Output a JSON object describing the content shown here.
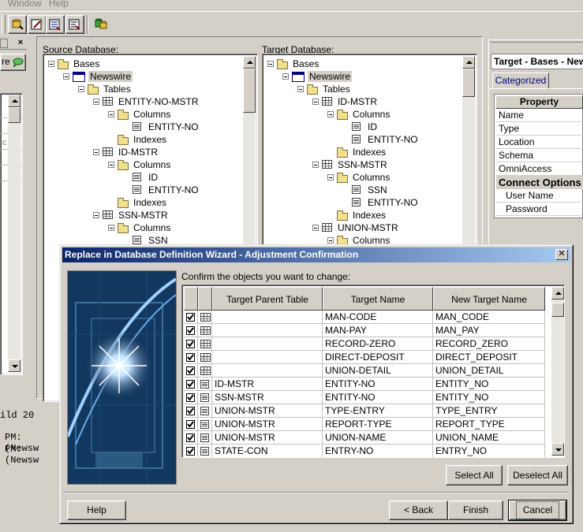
{
  "menu": [
    "Window",
    "Help"
  ],
  "toolbar": {
    "icons": [
      "connect-db-icon",
      "edit-icon",
      "properties-icon",
      "compare-icon",
      "databases-icon"
    ]
  },
  "left_fragment": {
    "button_label": "re",
    "text_c": "c",
    "console_lines": [
      "ild 20",
      "PM: (Newsw",
      "PM: (Newsw"
    ]
  },
  "source": {
    "label": "Source Database:",
    "nodes": [
      {
        "text": "Bases",
        "icon": "folder-icon"
      },
      {
        "text": "Newswire",
        "icon": "database-icon"
      },
      {
        "text": "Tables",
        "icon": "folder-icon"
      },
      {
        "text": "ENTITY-NO-MSTR",
        "icon": "table-icon"
      },
      {
        "text": "Columns",
        "icon": "folder-icon"
      },
      {
        "text": "ENTITY-NO",
        "icon": "column-icon"
      },
      {
        "text": "Indexes",
        "icon": "folder-icon"
      },
      {
        "text": "ID-MSTR",
        "icon": "table-icon"
      },
      {
        "text": "Columns",
        "icon": "folder-icon"
      },
      {
        "text": "ID",
        "icon": "column-icon"
      },
      {
        "text": "ENTITY-NO",
        "icon": "column-icon"
      },
      {
        "text": "Indexes",
        "icon": "folder-icon"
      },
      {
        "text": "SSN-MSTR",
        "icon": "table-icon"
      },
      {
        "text": "Columns",
        "icon": "folder-icon"
      },
      {
        "text": "SSN",
        "icon": "column-icon"
      }
    ]
  },
  "target": {
    "label": "Target Database:",
    "nodes": [
      {
        "text": "Bases",
        "icon": "folder-icon"
      },
      {
        "text": "Newswire",
        "icon": "database-icon"
      },
      {
        "text": "Tables",
        "icon": "folder-icon"
      },
      {
        "text": "ID-MSTR",
        "icon": "table-icon"
      },
      {
        "text": "Columns",
        "icon": "folder-icon"
      },
      {
        "text": "ID",
        "icon": "column-icon"
      },
      {
        "text": "ENTITY-NO",
        "icon": "column-icon"
      },
      {
        "text": "Indexes",
        "icon": "folder-icon"
      },
      {
        "text": "SSN-MSTR",
        "icon": "table-icon"
      },
      {
        "text": "Columns",
        "icon": "folder-icon"
      },
      {
        "text": "SSN",
        "icon": "column-icon"
      },
      {
        "text": "ENTITY-NO",
        "icon": "column-icon"
      },
      {
        "text": "Indexes",
        "icon": "folder-icon"
      },
      {
        "text": "UNION-MSTR",
        "icon": "table-icon"
      },
      {
        "text": "Columns",
        "icon": "folder-icon"
      }
    ]
  },
  "properties": {
    "title": "Target - Bases - New",
    "tab": "Categorized",
    "header": "Property",
    "rows": [
      "Name",
      "Type",
      "Location",
      "Schema",
      "OmniAccess"
    ],
    "section": "Connect Options",
    "sub_rows": [
      "User Name",
      "Password"
    ]
  },
  "dialog": {
    "title": "Replace in Database Definition Wizard - Adjustment Confirmation",
    "instruction": "Confirm the objects you want to change:",
    "columns": [
      "Target Parent Table",
      "Target Name",
      "New Target Name"
    ],
    "rows": [
      {
        "checked": true,
        "icon": "table-icon",
        "parent": "",
        "name": "MAN-CODE",
        "new_name": "MAN_CODE"
      },
      {
        "checked": true,
        "icon": "table-icon",
        "parent": "",
        "name": "MAN-PAY",
        "new_name": "MAN_PAY"
      },
      {
        "checked": true,
        "icon": "table-icon",
        "parent": "",
        "name": "RECORD-ZERO",
        "new_name": "RECORD_ZERO"
      },
      {
        "checked": true,
        "icon": "table-icon",
        "parent": "",
        "name": "DIRECT-DEPOSIT",
        "new_name": "DIRECT_DEPOSIT"
      },
      {
        "checked": true,
        "icon": "table-icon",
        "parent": "",
        "name": "UNION-DETAIL",
        "new_name": "UNION_DETAIL"
      },
      {
        "checked": true,
        "icon": "column-icon",
        "parent": "ID-MSTR",
        "name": "ENTITY-NO",
        "new_name": "ENTITY_NO"
      },
      {
        "checked": true,
        "icon": "column-icon",
        "parent": "SSN-MSTR",
        "name": "ENTITY-NO",
        "new_name": "ENTITY_NO"
      },
      {
        "checked": true,
        "icon": "column-icon",
        "parent": "UNION-MSTR",
        "name": "TYPE-ENTRY",
        "new_name": "TYPE_ENTRY"
      },
      {
        "checked": true,
        "icon": "column-icon",
        "parent": "UNION-MSTR",
        "name": "REPORT-TYPE",
        "new_name": "REPORT_TYPE"
      },
      {
        "checked": true,
        "icon": "column-icon",
        "parent": "UNION-MSTR",
        "name": "UNION-NAME",
        "new_name": "UNION_NAME"
      },
      {
        "checked": true,
        "icon": "column-icon",
        "parent": "STATE-CON",
        "name": "ENTRY-NO",
        "new_name": "ENTRY_NO"
      }
    ],
    "buttons": {
      "select_all": "Select All",
      "deselect_all": "Deselect All",
      "help": "Help",
      "back": "< Back",
      "finish": "Finish",
      "cancel": "Cancel"
    }
  }
}
